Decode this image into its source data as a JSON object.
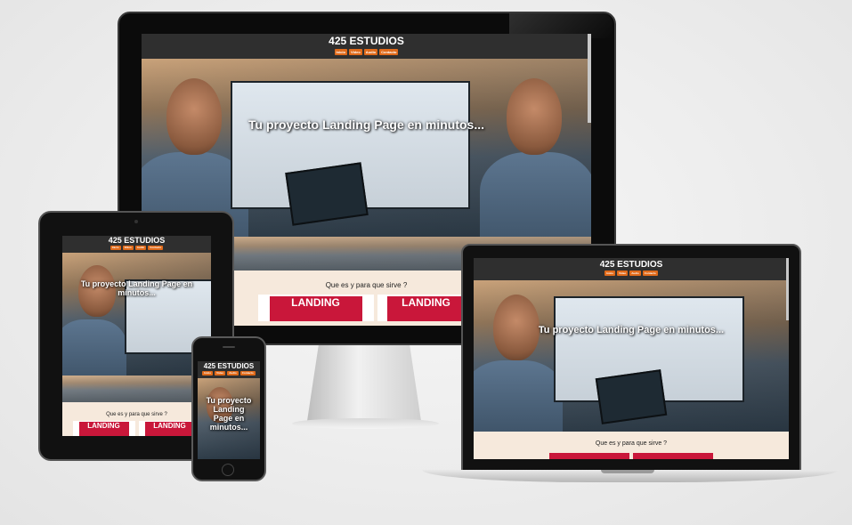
{
  "site": {
    "title": "425 ESTUDIOS",
    "nav": [
      "Inicio",
      "Video",
      "Audio",
      "Contacto"
    ],
    "hero_text": "Tu proyecto Landing Page en minutos...",
    "section_heading": "Que es y para que sirve ?",
    "thumb_text": "LANDING"
  },
  "colors": {
    "header_bg": "#2f2f2f",
    "nav_accent": "#e06a1a",
    "section_bg": "#f6e9dc",
    "thumb_accent": "#c9173a"
  },
  "devices": [
    "desktop-monitor",
    "tablet",
    "laptop",
    "phone"
  ]
}
